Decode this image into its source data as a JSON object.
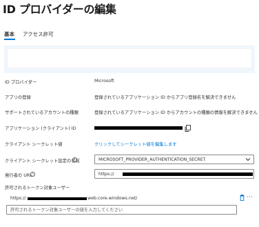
{
  "header": {
    "title": "ID プロバイダーの編集",
    "more_label": "···"
  },
  "tabs": [
    {
      "label": "基本",
      "active": true
    },
    {
      "label": "アクセス許可",
      "active": false
    }
  ],
  "fields": {
    "idp_label": "ID プロバイダー",
    "idp_value": "Microsoft",
    "app_reg_label": "アプリの登録",
    "app_reg_value": "登録されているアプリケーション ID からアプリ登録名を解決できません",
    "account_types_label": "サポートされているアカウントの種類",
    "account_types_value": "登録されているアプリケーション ID からアカウントの種類の情報を解決できません",
    "client_id_label": "アプリケーション (クライアント) ID",
    "client_secret_label": "クライアント シークレット値",
    "client_secret_link": "クリックしてシークレット値を編集します",
    "secret_setting_label": "クライアント シークレット設定の名前",
    "secret_setting_value": "MICROSOFT_PROVIDER_AUTHENTICATION_SECRET",
    "issuer_label": "発行者の URL",
    "issuer_value": "https://",
    "audiences_label": "許可されるトークン対象ユーザー",
    "audience_prefix": "https://",
    "audience_suffix": "web.core.windows.net/",
    "audience_placeholder": "許可されるトークン対象ユーザーの値を入力してください",
    "more_label": "···"
  },
  "icons": {
    "copy": "copy-icon",
    "info": "info-icon",
    "chevron": "chevron-down-icon",
    "trash": "trash-icon"
  },
  "colors": {
    "accent": "#0078d4",
    "banner": "#eff6fc"
  }
}
